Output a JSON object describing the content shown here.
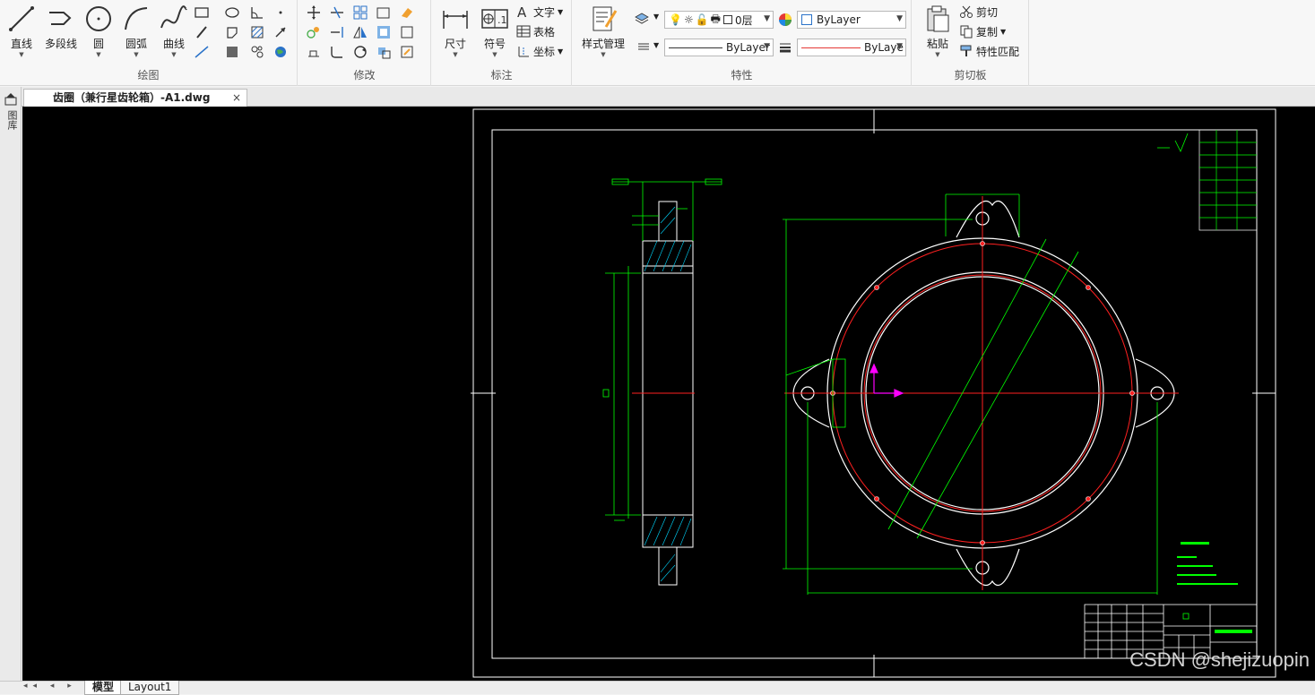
{
  "ribbon": {
    "groups": {
      "draw": "绘图",
      "modify": "修改",
      "annotate": "标注",
      "properties": "特性",
      "clipboard": "剪切板"
    },
    "draw_tools": {
      "line": "直线",
      "polyline": "多段线",
      "circle": "圆",
      "arc": "圆弧",
      "curve": "曲线"
    },
    "annotate_tools": {
      "dimension": "尺寸",
      "symbol": "符号",
      "text": "文字",
      "table": "表格",
      "coordinate": "坐标"
    },
    "properties_tools": {
      "style_manager": "样式管理",
      "layer": "0层",
      "color": "ByLayer",
      "linetype": "ByLayer",
      "lineweight": "ByLaye"
    },
    "clipboard_tools": {
      "paste": "粘贴",
      "cut": "剪切",
      "copy": "复制",
      "match_properties": "特性匹配"
    }
  },
  "tabs": {
    "document": "齿圈（兼行星齿轮箱）-A1.dwg",
    "close": "×"
  },
  "sidebar": {
    "label": "图库"
  },
  "bottom": {
    "nav": "◂◂ ◂ ▸ ▸▸",
    "model_tab": "模型",
    "layout_tab": "Layout1"
  },
  "watermark": "CSDN @shejizuopin",
  "colors": {
    "ribbon_bg": "#f7f7f7",
    "canvas_bg": "#000000",
    "drawing_white": "#ffffff",
    "dimension_green": "#00ff00",
    "centerline_red": "#ff0000",
    "ucs_magenta": "#ff00ff"
  }
}
